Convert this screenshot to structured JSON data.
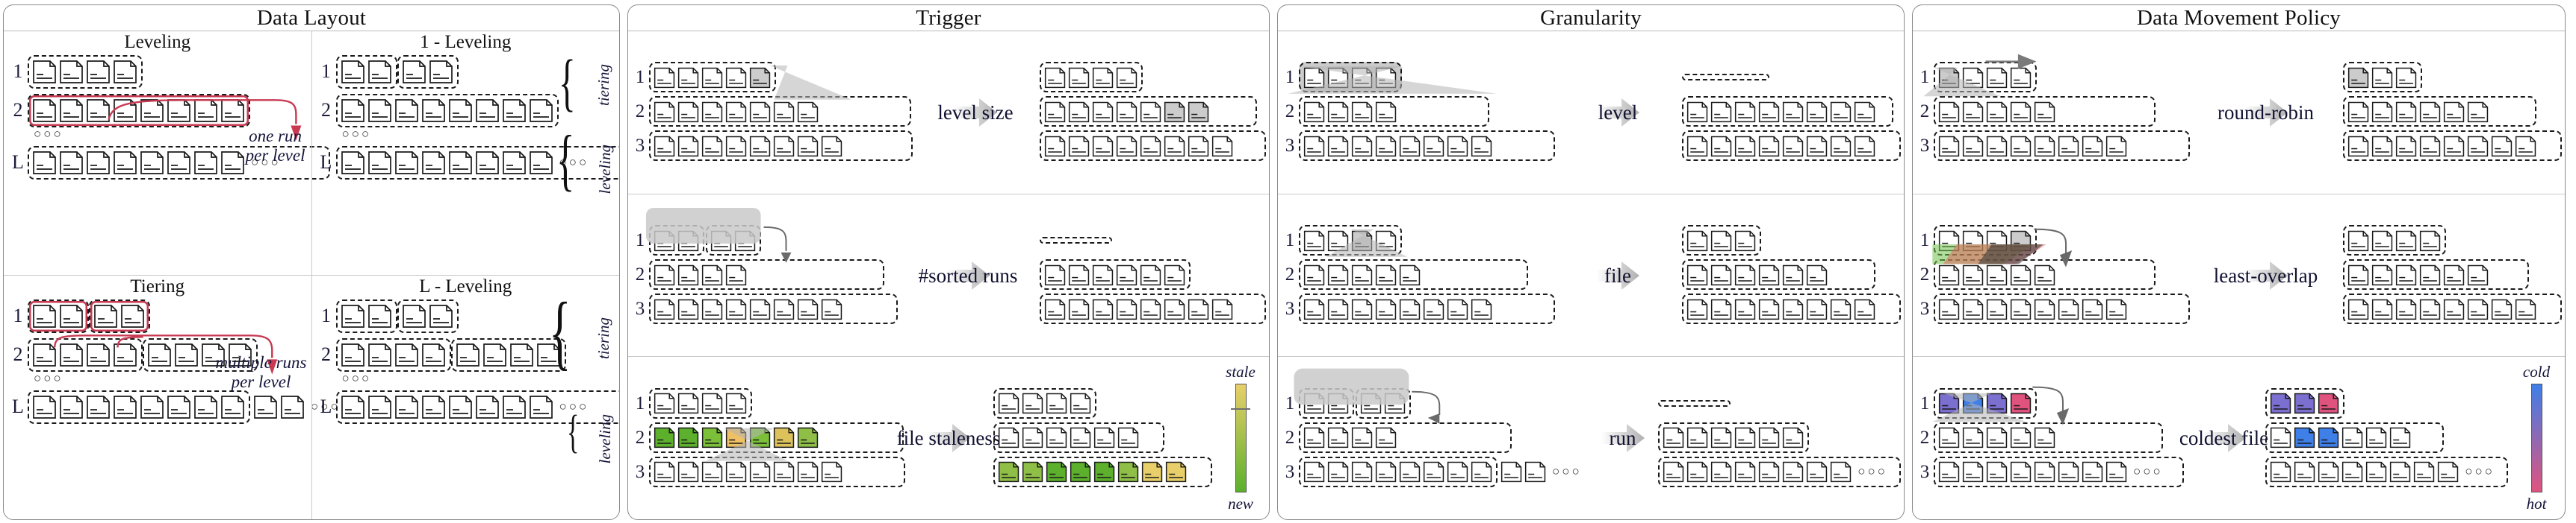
{
  "panels": [
    {
      "title": "Data Layout"
    },
    {
      "title": "Trigger"
    },
    {
      "title": "Granularity"
    },
    {
      "title": "Data Movement Policy"
    }
  ],
  "data_layout": {
    "quadrants": [
      {
        "title": "Leveling",
        "note": "one run\nper level",
        "levels": [
          "1",
          "2",
          "L"
        ],
        "brace": ""
      },
      {
        "title": "1 - Leveling",
        "note": "",
        "levels": [
          "1",
          "2",
          "L"
        ],
        "brace_top": "tiering",
        "brace_bottom": "leveling"
      },
      {
        "title": "Tiering",
        "note": "multiple runs\nper level",
        "levels": [
          "1",
          "2",
          "L"
        ],
        "brace": ""
      },
      {
        "title": "L - Leveling",
        "note": "",
        "levels": [
          "1",
          "2",
          "L"
        ],
        "brace_top": "tiering",
        "brace_bottom": "leveling"
      }
    ],
    "note_leveling_line1": "one run",
    "note_leveling_line2": "per level",
    "note_tiering_line1": "multiple runs",
    "note_tiering_line2": "per level",
    "brace_tiering": "tiering",
    "brace_leveling": "leveling",
    "ellipsis": "○○○"
  },
  "trigger": {
    "bands": [
      {
        "label": "level size"
      },
      {
        "label": "#sorted runs"
      },
      {
        "label": "file staleness"
      }
    ],
    "levels": [
      "1",
      "2",
      "3"
    ],
    "legend": {
      "top": "stale",
      "bottom": "new",
      "top_color": "#e8cf6a",
      "bottom_color": "#5cb02c"
    }
  },
  "granularity": {
    "bands": [
      {
        "label": "level"
      },
      {
        "label": "file"
      },
      {
        "label": "run"
      }
    ],
    "levels": [
      "1",
      "2",
      "3"
    ]
  },
  "movement": {
    "bands": [
      {
        "label": "round-robin"
      },
      {
        "label": "least-overlap"
      },
      {
        "label": "coldest file"
      }
    ],
    "levels": [
      "1",
      "2",
      "3"
    ],
    "legend": {
      "top": "cold",
      "bottom": "hot",
      "top_color": "#3f7fe8",
      "bottom_color": "#e0537f"
    }
  },
  "colors": {
    "highlight_gray": "#cccccc",
    "red_outline": "#c83a52",
    "green_new": "#5cb02c",
    "yellow_stale": "#e8cf6a",
    "blue_cold": "#3f7fe8",
    "pink_hot": "#e0537f",
    "purple_mid": "#7b6fd0"
  }
}
